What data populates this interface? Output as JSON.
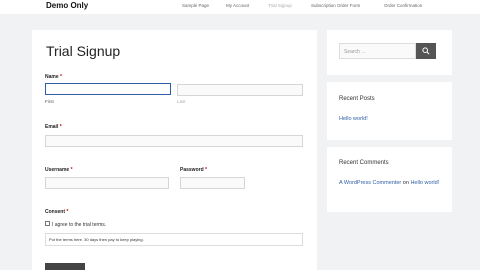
{
  "header": {
    "brand": "Demo Only",
    "nav": [
      "Sample Page",
      "My Account",
      "Trial Signup",
      "Subscription Order Form",
      "Order Confirmation"
    ]
  },
  "form": {
    "title": "Trial Signup",
    "name_label": "Name",
    "first_label": "First",
    "last_label": "Last",
    "email_label": "Email",
    "username_label": "Username",
    "password_label": "Password",
    "consent_label": "Consent",
    "required_marker": "*",
    "consent_text": "I agree to the trial terms.",
    "terms_text": "Put the terms here. 30 days then pay to keep playing.",
    "values": {
      "first": "",
      "last": "",
      "email": "",
      "username": "",
      "password": ""
    },
    "consent_checked": false
  },
  "sidebar": {
    "search_placeholder": "Search ...",
    "recent_posts_title": "Recent Posts",
    "recent_post": "Hello world!",
    "recent_comments_title": "Recent Comments",
    "comment_author": "A WordPress Commenter",
    "comment_on": "on",
    "comment_post": "Hello world!"
  },
  "colors": {
    "accent": "#2f5fa8",
    "button": "#444444",
    "background": "#f1f2f4"
  }
}
